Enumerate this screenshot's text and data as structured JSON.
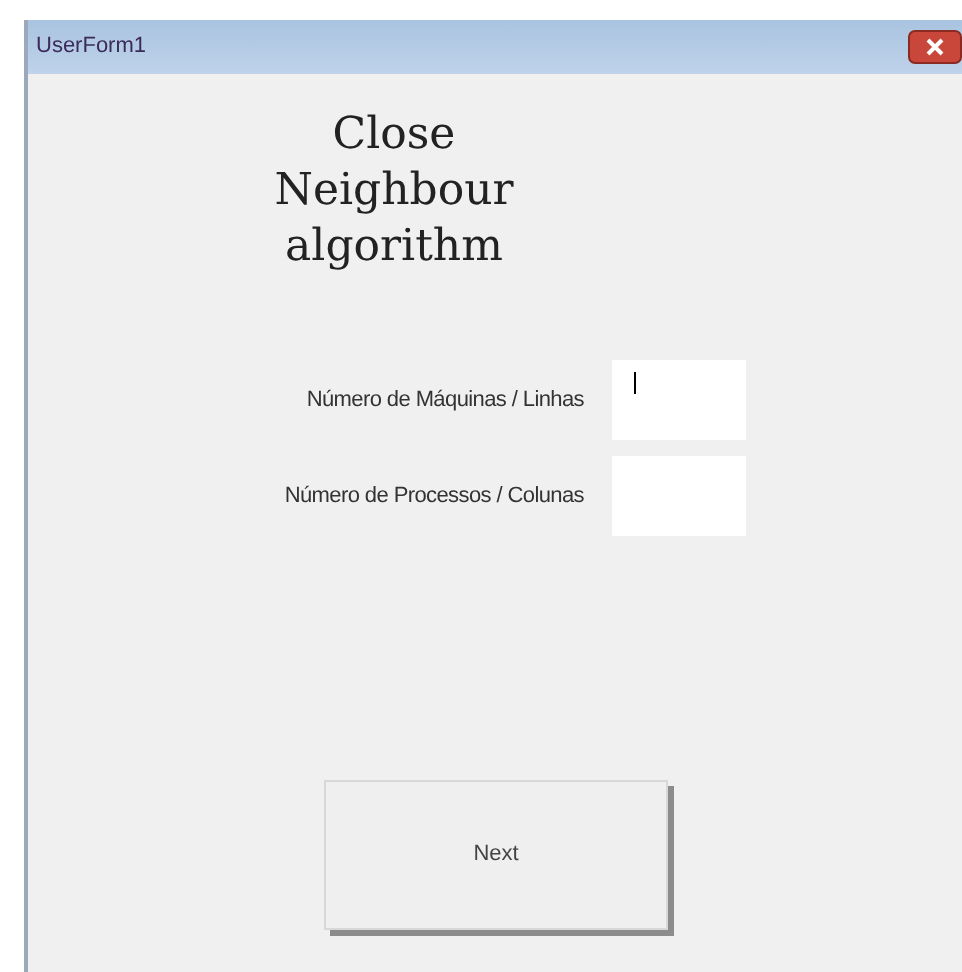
{
  "window": {
    "title": "UserForm1"
  },
  "heading": [
    "Close",
    "Neighbour",
    "algorithm"
  ],
  "fields": [
    {
      "label": "Número de Máquinas / Linhas",
      "focused": true
    },
    {
      "label": "Número de Processos / Colunas",
      "focused": false
    }
  ],
  "buttons": [
    "Next"
  ]
}
